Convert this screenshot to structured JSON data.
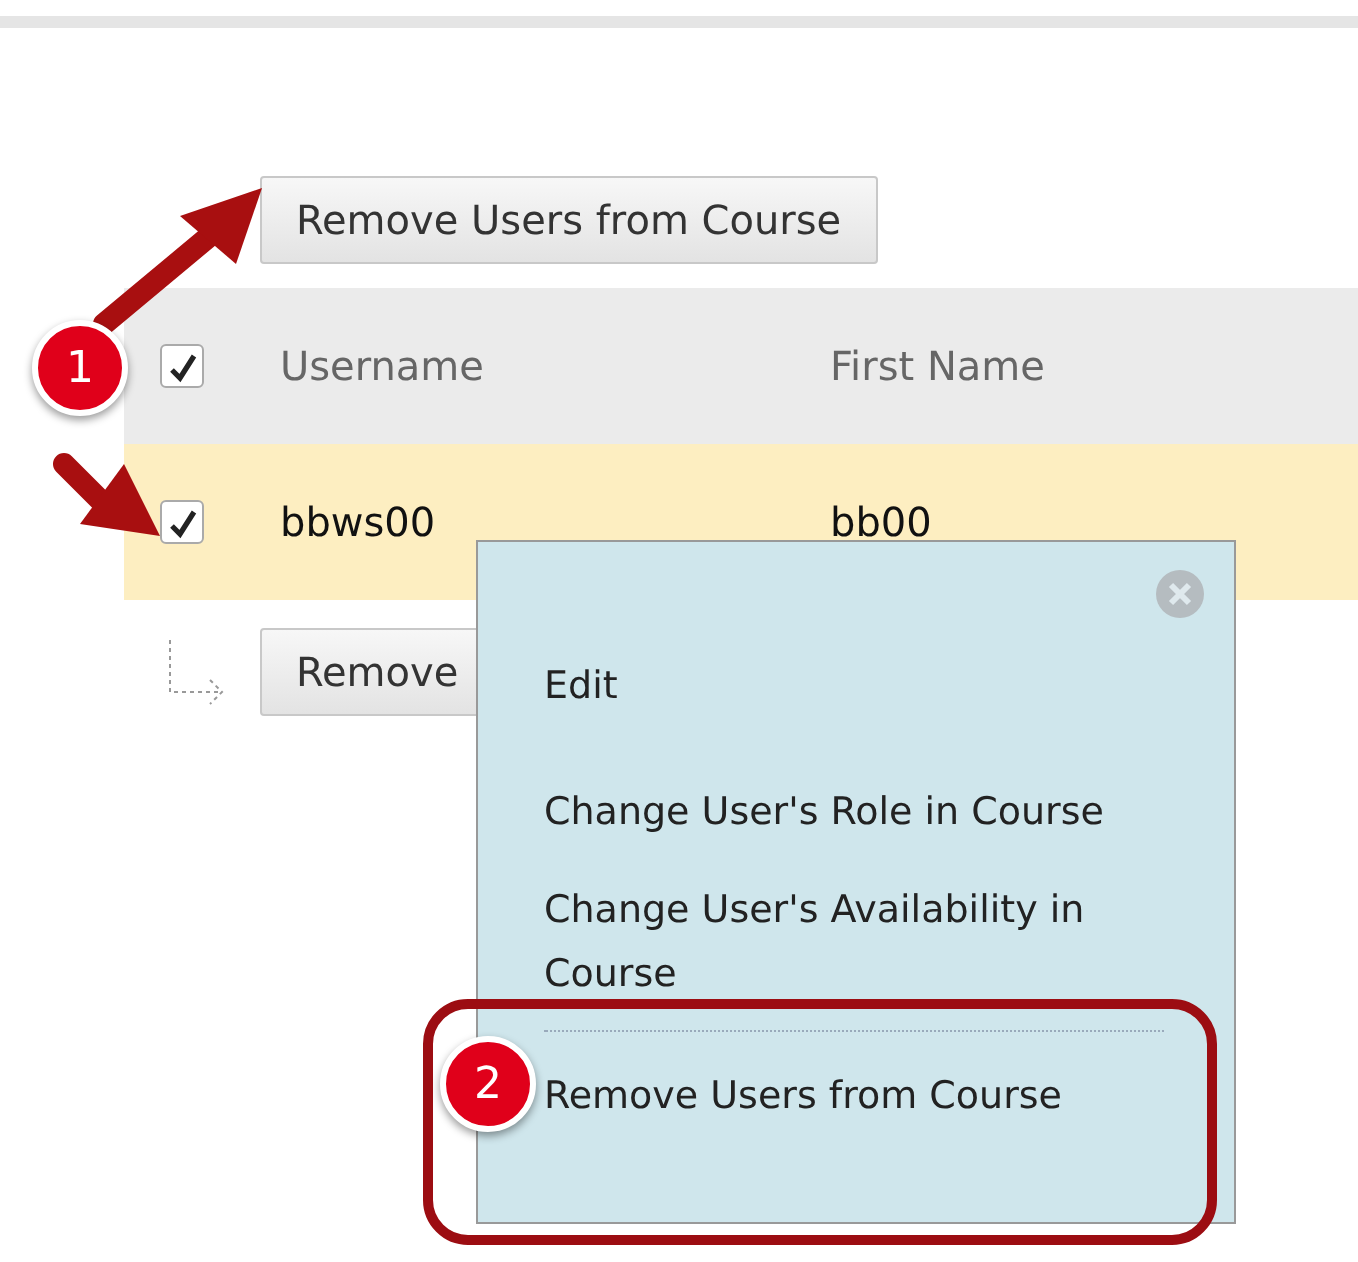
{
  "top_button": {
    "label": "Remove Users from Course"
  },
  "table": {
    "header_checkbox": {
      "checked": true
    },
    "columns": [
      "Username",
      "First Name"
    ],
    "rows": [
      {
        "selected": true,
        "checked": true,
        "cells": [
          "bbws00",
          "bb00"
        ]
      }
    ]
  },
  "bottom_button": {
    "label": "Remove"
  },
  "context_menu": {
    "items": [
      {
        "label": "Edit",
        "divider": false
      },
      {
        "label": "Change User's Role in Course",
        "divider": false
      },
      {
        "label": "Change User's Availability in Course",
        "divider": false
      },
      {
        "label": "Remove Users from Course",
        "divider": true
      }
    ]
  },
  "annotations": [
    {
      "number": "1"
    },
    {
      "number": "2"
    }
  ]
}
